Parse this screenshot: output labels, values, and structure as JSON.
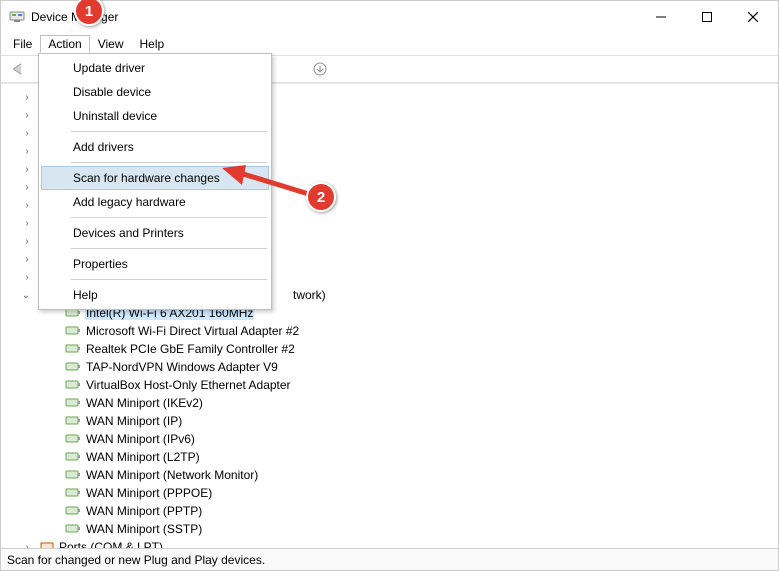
{
  "window": {
    "title": "Device Manager"
  },
  "menubar": {
    "file": "File",
    "action": "Action",
    "view": "View",
    "help": "Help"
  },
  "action_menu": {
    "update_driver": "Update driver",
    "disable_device": "Disable device",
    "uninstall_device": "Uninstall device",
    "add_drivers": "Add drivers",
    "scan_hardware": "Scan for hardware changes",
    "add_legacy": "Add legacy hardware",
    "devices_printers": "Devices and Printers",
    "properties": "Properties",
    "help": "Help"
  },
  "tree": {
    "visible_partial_category": "twork)",
    "network_adapters": [
      "Intel(R) Wi-Fi 6 AX201 160MHz",
      "Microsoft Wi-Fi Direct Virtual Adapter #2",
      "Realtek PCIe GbE Family Controller #2",
      "TAP-NordVPN Windows Adapter V9",
      "VirtualBox Host-Only Ethernet Adapter",
      "WAN Miniport (IKEv2)",
      "WAN Miniport (IP)",
      "WAN Miniport (IPv6)",
      "WAN Miniport (L2TP)",
      "WAN Miniport (Network Monitor)",
      "WAN Miniport (PPPOE)",
      "WAN Miniport (PPTP)",
      "WAN Miniport (SSTP)"
    ],
    "next_category_partial": "Ports (COM & LPT)"
  },
  "statusbar": {
    "text": "Scan for changed or new Plug and Play devices."
  },
  "annotations": {
    "badge1": "1",
    "badge2": "2"
  }
}
